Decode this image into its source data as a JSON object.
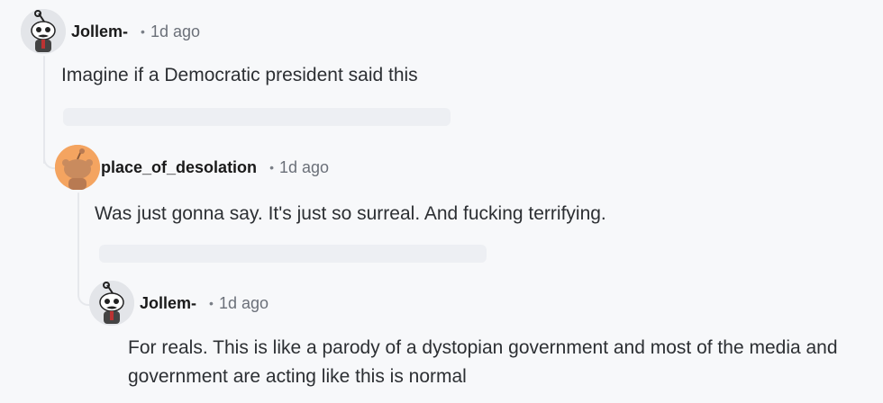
{
  "comments": [
    {
      "username": "Jollem-",
      "separator": "•",
      "time": "1d ago",
      "body": "Imagine if a Democratic president said this"
    },
    {
      "username": "place_of_desolation",
      "separator": "•",
      "time": "1d ago",
      "body": "Was just gonna say. It's just so surreal. And fucking terrifying."
    },
    {
      "username": "Jollem-",
      "separator": "•",
      "time": "1d ago",
      "body": "For reals. This is like a parody of a dystopian government and most of the media and government are acting like this is normal"
    }
  ],
  "colors": {
    "thread_line": "#e6e8ec",
    "orange_avatar": "#f4a460",
    "gray_avatar": "#e3e5e9"
  }
}
